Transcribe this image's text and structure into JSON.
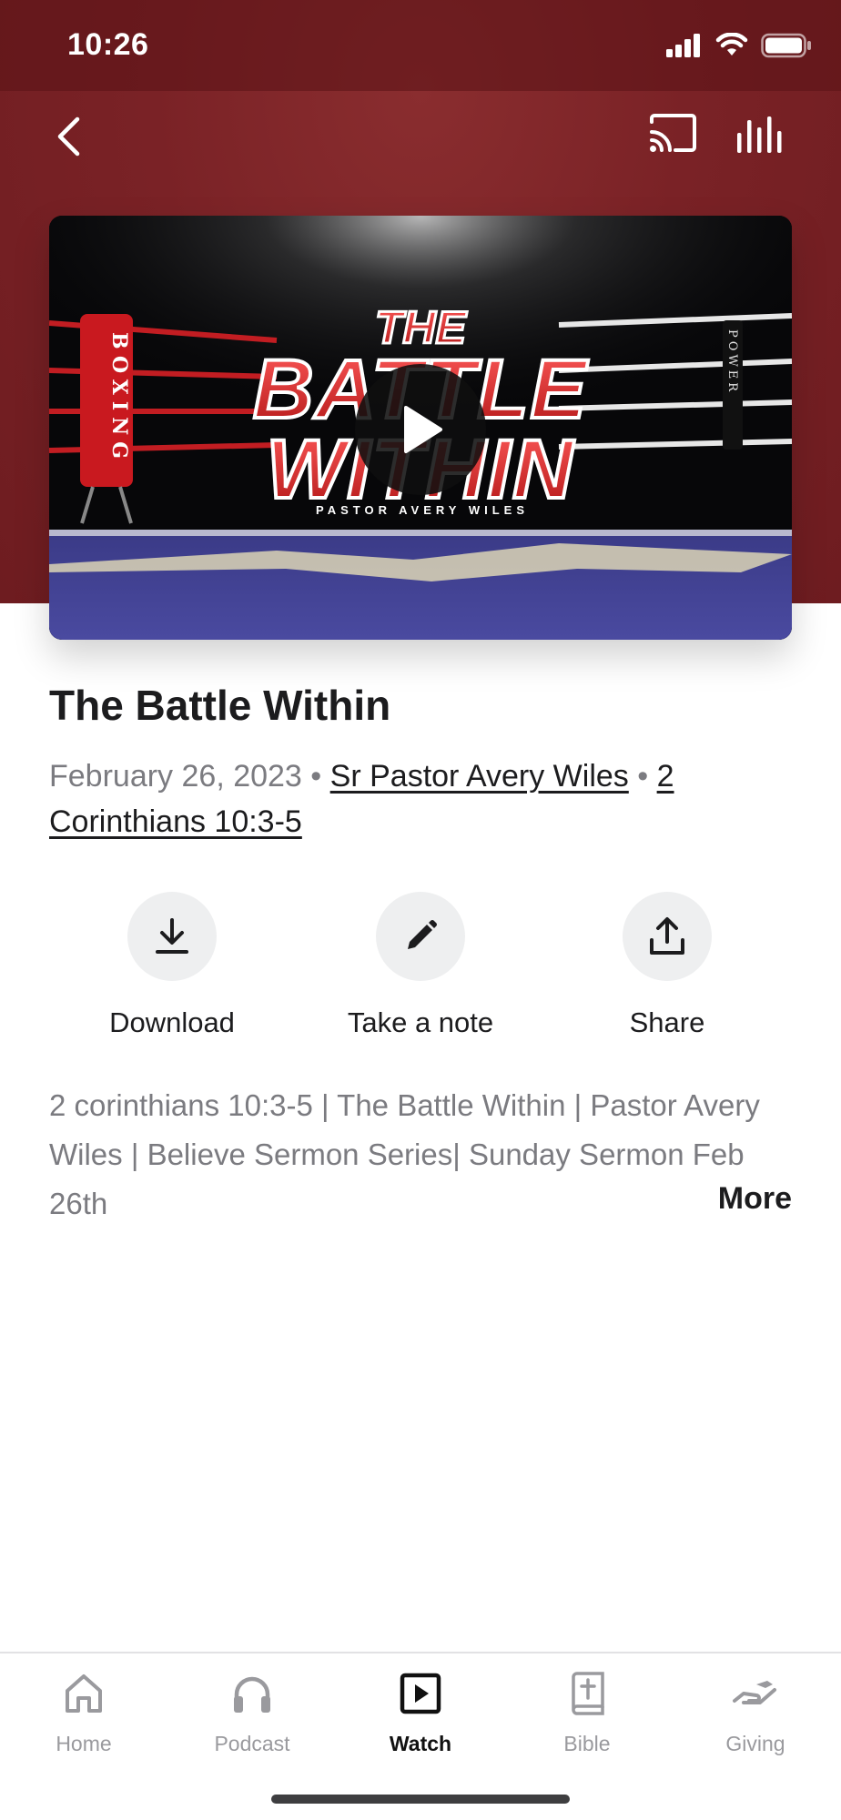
{
  "status_bar": {
    "time": "10:26"
  },
  "colors": {
    "header": "#7a2226",
    "accent_underline": "#1c1c1e",
    "meta_gray": "#7b7b80",
    "tab_inactive": "#9a9a9e"
  },
  "video": {
    "art_title_top": "THE",
    "art_title_mid": "BATTLE",
    "art_title_bottom": "WITHIN",
    "art_subtitle": "PASTOR AVERY WILES",
    "art_corner_left": "BOXING",
    "art_corner_right": "POWER"
  },
  "sermon": {
    "title": "The Battle Within",
    "date": "February 26, 2023",
    "separator": "•",
    "speaker": "Sr Pastor Avery Wiles",
    "scripture": "2 Corinthians 10:3-5",
    "description": "2 corinthians 10:3-5 | The Battle Within | Pastor Avery Wiles | Believe Sermon Series| Sunday Sermon Feb 26th",
    "more_label": "More"
  },
  "actions": [
    {
      "label": "Download",
      "icon": "download-icon"
    },
    {
      "label": "Take a note",
      "icon": "pencil-icon"
    },
    {
      "label": "Share",
      "icon": "share-icon"
    }
  ],
  "tabs": [
    {
      "label": "Home",
      "icon": "home-icon"
    },
    {
      "label": "Podcast",
      "icon": "headphones-icon"
    },
    {
      "label": "Watch",
      "icon": "play-square-icon",
      "active": true
    },
    {
      "label": "Bible",
      "icon": "bible-icon"
    },
    {
      "label": "Giving",
      "icon": "giving-icon"
    }
  ]
}
